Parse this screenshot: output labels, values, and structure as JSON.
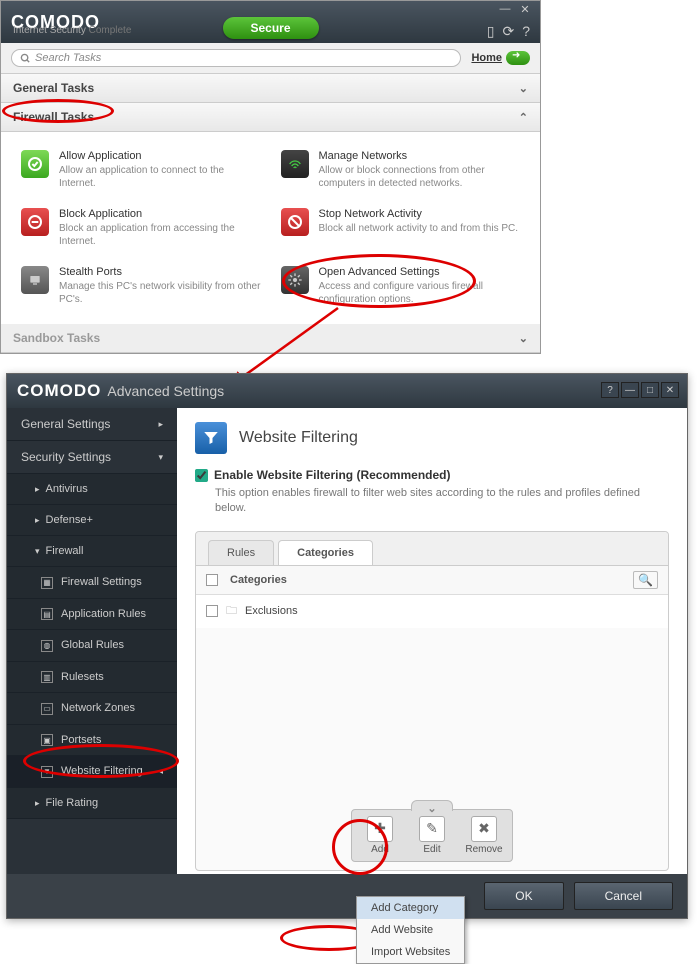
{
  "window1": {
    "logo": "COMODO",
    "subtitle_prefix": "Internet Security",
    "subtitle_suffix": " Complete",
    "secure_label": "Secure",
    "search_placeholder": "Search Tasks",
    "home_label": "Home",
    "sections": {
      "general": "General Tasks",
      "firewall": "Firewall Tasks",
      "sandbox": "Sandbox Tasks"
    },
    "tasks": [
      {
        "title": "Allow Application",
        "desc": "Allow an application to connect to the Internet."
      },
      {
        "title": "Manage Networks",
        "desc": "Allow or block connections from other computers in detected networks."
      },
      {
        "title": "Block Application",
        "desc": "Block an application from accessing the Internet."
      },
      {
        "title": "Stop Network Activity",
        "desc": "Block all network activity to and from this PC."
      },
      {
        "title": "Stealth Ports",
        "desc": "Manage this PC's network visibility from other PC's."
      },
      {
        "title": "Open Advanced Settings",
        "desc": "Access and configure various firewall configuration options."
      }
    ]
  },
  "window2": {
    "logo": "COMODO",
    "title": "Advanced Settings",
    "sidebar": {
      "general": "General Settings",
      "security": "Security Settings",
      "antivirus": "Antivirus",
      "defense": "Defense+",
      "firewall": "Firewall",
      "fw_settings": "Firewall Settings",
      "app_rules": "Application Rules",
      "global_rules": "Global Rules",
      "rulesets": "Rulesets",
      "network_zones": "Network Zones",
      "portsets": "Portsets",
      "website_filtering": "Website Filtering",
      "file_rating": "File Rating"
    },
    "panel": {
      "title": "Website Filtering",
      "enable_label": "Enable Website Filtering (Recommended)",
      "enable_desc": "This option enables firewall to filter web sites according to the rules and profiles defined below.",
      "tabs": {
        "rules": "Rules",
        "categories": "Categories"
      },
      "table_header": "Categories",
      "rows": [
        "Exclusions"
      ],
      "toolbar": {
        "add": "Add",
        "edit": "Edit",
        "remove": "Remove"
      },
      "menu": {
        "add_category": "Add Category",
        "add_website": "Add Website",
        "import_websites": "Import Websites"
      }
    },
    "buttons": {
      "ok": "OK",
      "cancel": "Cancel"
    }
  }
}
